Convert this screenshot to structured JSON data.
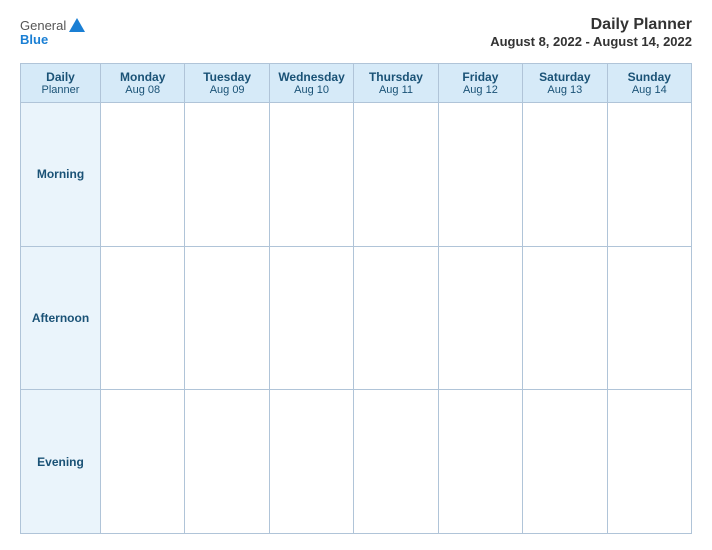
{
  "header": {
    "logo": {
      "general": "General",
      "blue": "Blue",
      "icon": "▶"
    },
    "title": "Daily Planner",
    "dates": "August 8, 2022 - August 14, 2022"
  },
  "table": {
    "header_col": {
      "line1": "Daily",
      "line2": "Planner"
    },
    "days": [
      {
        "name": "Monday",
        "date": "Aug 08"
      },
      {
        "name": "Tuesday",
        "date": "Aug 09"
      },
      {
        "name": "Wednesday",
        "date": "Aug 10"
      },
      {
        "name": "Thursday",
        "date": "Aug 11"
      },
      {
        "name": "Friday",
        "date": "Aug 12"
      },
      {
        "name": "Saturday",
        "date": "Aug 13"
      },
      {
        "name": "Sunday",
        "date": "Aug 14"
      }
    ],
    "rows": [
      {
        "label": "Morning"
      },
      {
        "label": "Afternoon"
      },
      {
        "label": "Evening"
      }
    ]
  }
}
